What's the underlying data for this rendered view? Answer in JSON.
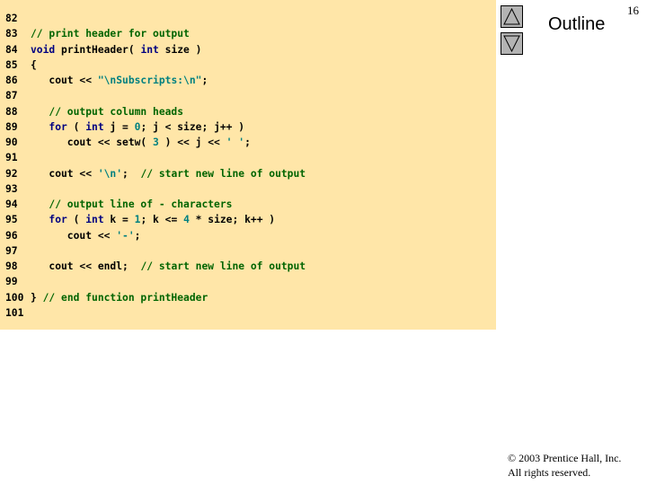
{
  "page_number": "16",
  "outline_title": "Outline",
  "nav": {
    "up_icon": "triangle-up-icon",
    "down_icon": "triangle-down-icon",
    "button_color": "#b3b3b3"
  },
  "code_panel_color": "#ffe6a8",
  "code_lines": [
    {
      "number": "82",
      "tokens": []
    },
    {
      "number": "83",
      "tokens": [
        {
          "type": "comment",
          "text": "// print header for output"
        }
      ]
    },
    {
      "number": "84",
      "tokens": [
        {
          "type": "keyword",
          "text": "void"
        },
        {
          "type": "plain",
          "text": " printHeader( "
        },
        {
          "type": "keyword",
          "text": "int"
        },
        {
          "type": "plain",
          "text": " size )"
        }
      ]
    },
    {
      "number": "85",
      "tokens": [
        {
          "type": "plain",
          "text": "{"
        }
      ]
    },
    {
      "number": "86",
      "tokens": [
        {
          "type": "plain",
          "text": "   cout << "
        },
        {
          "type": "string",
          "text": "\"\\nSubscripts:\\n\""
        },
        {
          "type": "plain",
          "text": ";"
        }
      ]
    },
    {
      "number": "87",
      "tokens": []
    },
    {
      "number": "88",
      "tokens": [
        {
          "type": "plain",
          "text": "   "
        },
        {
          "type": "comment",
          "text": "// output column heads"
        }
      ]
    },
    {
      "number": "89",
      "tokens": [
        {
          "type": "plain",
          "text": "   "
        },
        {
          "type": "keyword",
          "text": "for"
        },
        {
          "type": "plain",
          "text": " ( "
        },
        {
          "type": "keyword",
          "text": "int"
        },
        {
          "type": "plain",
          "text": " j = "
        },
        {
          "type": "number",
          "text": "0"
        },
        {
          "type": "plain",
          "text": "; j < size; j++ )"
        }
      ]
    },
    {
      "number": "90",
      "tokens": [
        {
          "type": "plain",
          "text": "      cout << setw( "
        },
        {
          "type": "number",
          "text": "3"
        },
        {
          "type": "plain",
          "text": " ) << j << "
        },
        {
          "type": "string",
          "text": "' '"
        },
        {
          "type": "plain",
          "text": ";"
        }
      ]
    },
    {
      "number": "91",
      "tokens": []
    },
    {
      "number": "92",
      "tokens": [
        {
          "type": "plain",
          "text": "   cout << "
        },
        {
          "type": "string",
          "text": "'\\n'"
        },
        {
          "type": "plain",
          "text": ";  "
        },
        {
          "type": "comment",
          "text": "// start new line of output"
        }
      ]
    },
    {
      "number": "93",
      "tokens": []
    },
    {
      "number": "94",
      "tokens": [
        {
          "type": "plain",
          "text": "   "
        },
        {
          "type": "comment",
          "text": "// output line of - characters"
        }
      ]
    },
    {
      "number": "95",
      "tokens": [
        {
          "type": "plain",
          "text": "   "
        },
        {
          "type": "keyword",
          "text": "for"
        },
        {
          "type": "plain",
          "text": " ( "
        },
        {
          "type": "keyword",
          "text": "int"
        },
        {
          "type": "plain",
          "text": " k = "
        },
        {
          "type": "number",
          "text": "1"
        },
        {
          "type": "plain",
          "text": "; k <= "
        },
        {
          "type": "number",
          "text": "4"
        },
        {
          "type": "plain",
          "text": " * size; k++ )"
        }
      ]
    },
    {
      "number": "96",
      "tokens": [
        {
          "type": "plain",
          "text": "      cout << "
        },
        {
          "type": "string",
          "text": "'-'"
        },
        {
          "type": "plain",
          "text": ";"
        }
      ]
    },
    {
      "number": "97",
      "tokens": []
    },
    {
      "number": "98",
      "tokens": [
        {
          "type": "plain",
          "text": "   cout << endl;  "
        },
        {
          "type": "comment",
          "text": "// start new line of output"
        }
      ]
    },
    {
      "number": "99",
      "tokens": []
    },
    {
      "number": "100",
      "tokens": [
        {
          "type": "plain",
          "text": "} "
        },
        {
          "type": "comment",
          "text": "// end function printHeader"
        }
      ]
    },
    {
      "number": "101",
      "tokens": []
    }
  ],
  "copyright": {
    "line1": "© 2003 Prentice Hall, Inc.",
    "line2": "All rights reserved."
  }
}
